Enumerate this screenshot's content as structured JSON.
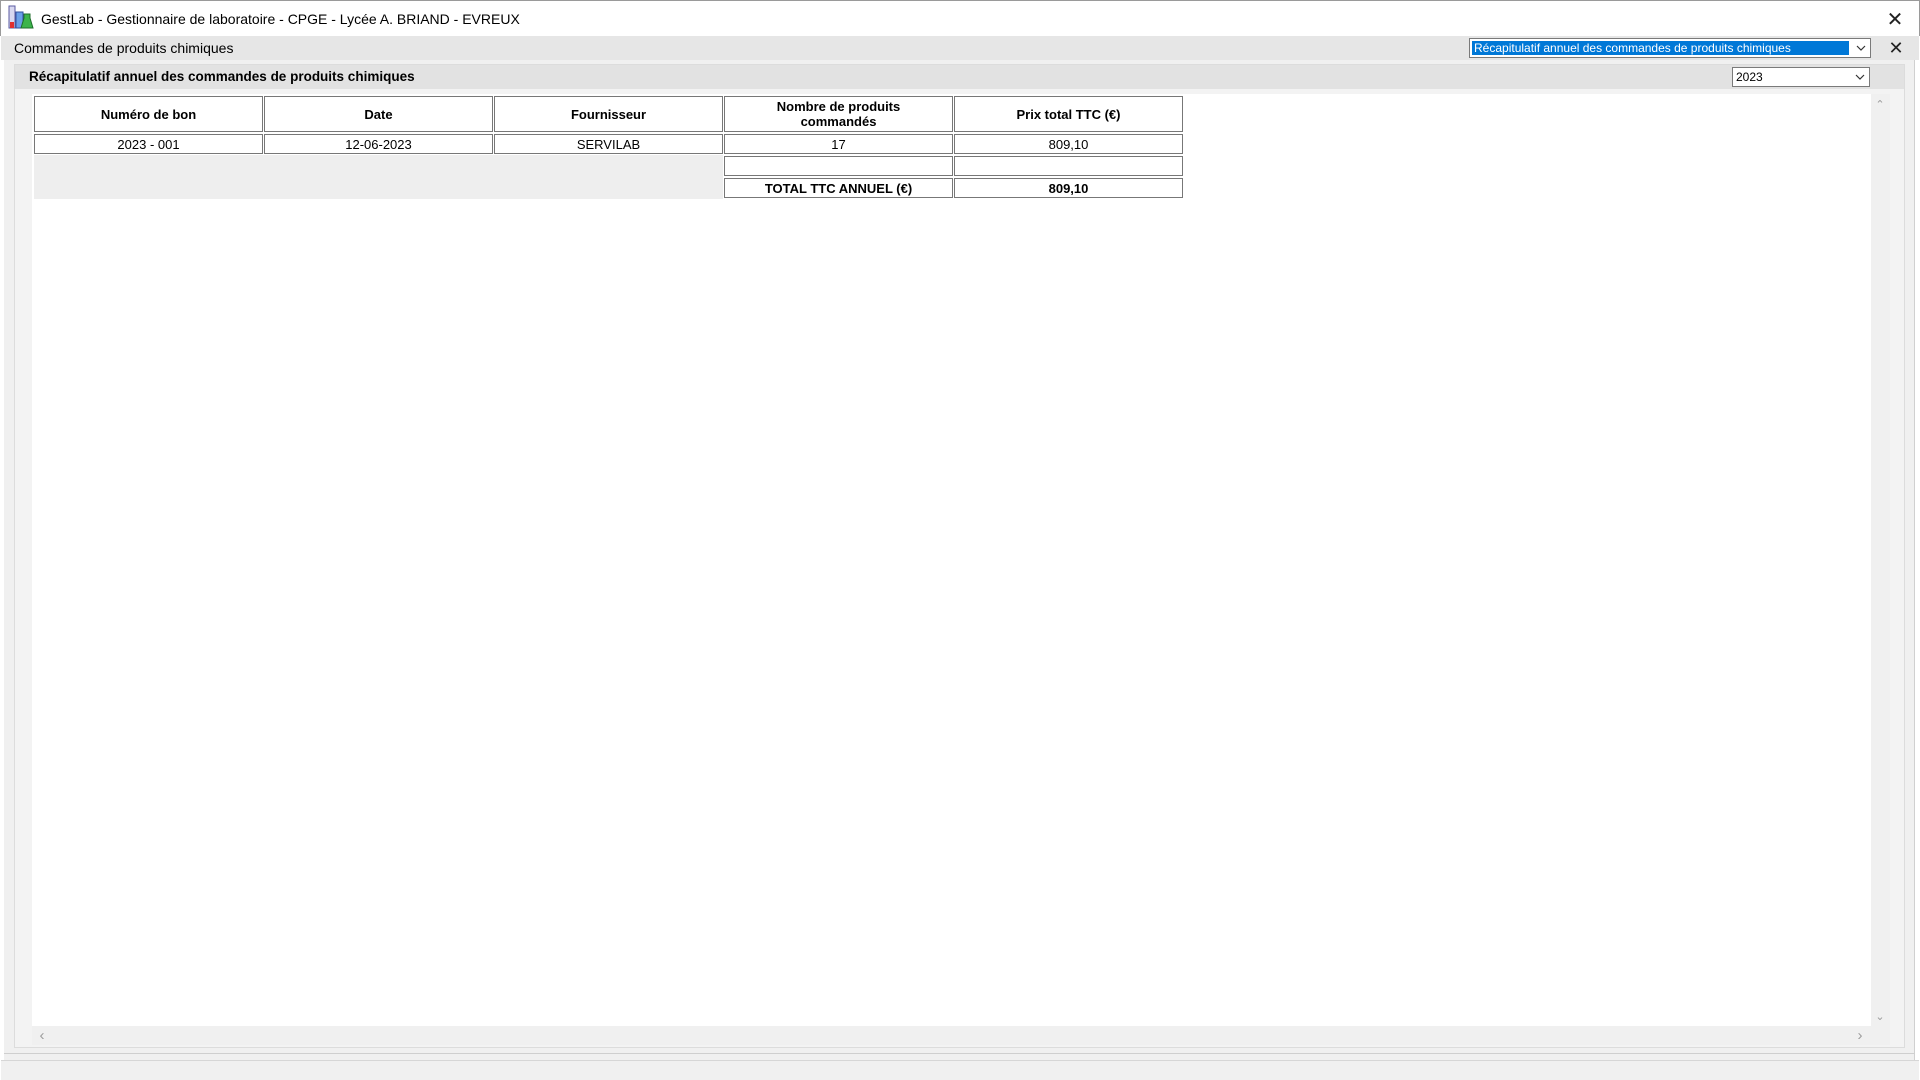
{
  "window": {
    "title": "GestLab - Gestionnaire de laboratoire - CPGE - Lycée A. BRIAND - EVREUX",
    "close_glyph": "✕"
  },
  "subbar": {
    "title": "Commandes de produits chimiques",
    "report_select_value": "Récapitulatif annuel des commandes de produits chimiques",
    "close_glyph": "✕"
  },
  "panel": {
    "title": "Récapitulatif annuel des commandes de produits chimiques",
    "year_select_value": "2023"
  },
  "table": {
    "headers": {
      "numero": "Numéro de bon",
      "date": "Date",
      "fournisseur": "Fournisseur",
      "nombre": "Nombre de produits commandés",
      "prix": "Prix total TTC (€)"
    },
    "rows": [
      {
        "numero": "2023 - 001",
        "date": "12-06-2023",
        "fournisseur": "SERVILAB",
        "nombre": "17",
        "prix": "809,10"
      }
    ],
    "total_label": "TOTAL TTC ANNUEL (€)",
    "total_value": "809,10"
  },
  "scroll": {
    "up": "⌃",
    "down": "⌄",
    "left": "‹",
    "right": "›"
  },
  "colors": {
    "selection": "#0078d7",
    "panel_header": "#e2e2e2",
    "subbar": "#e6e6e6"
  },
  "icons": {
    "app": "gestlab-app-icon",
    "dropdown": "chevron-down-icon",
    "close": "close-icon"
  }
}
